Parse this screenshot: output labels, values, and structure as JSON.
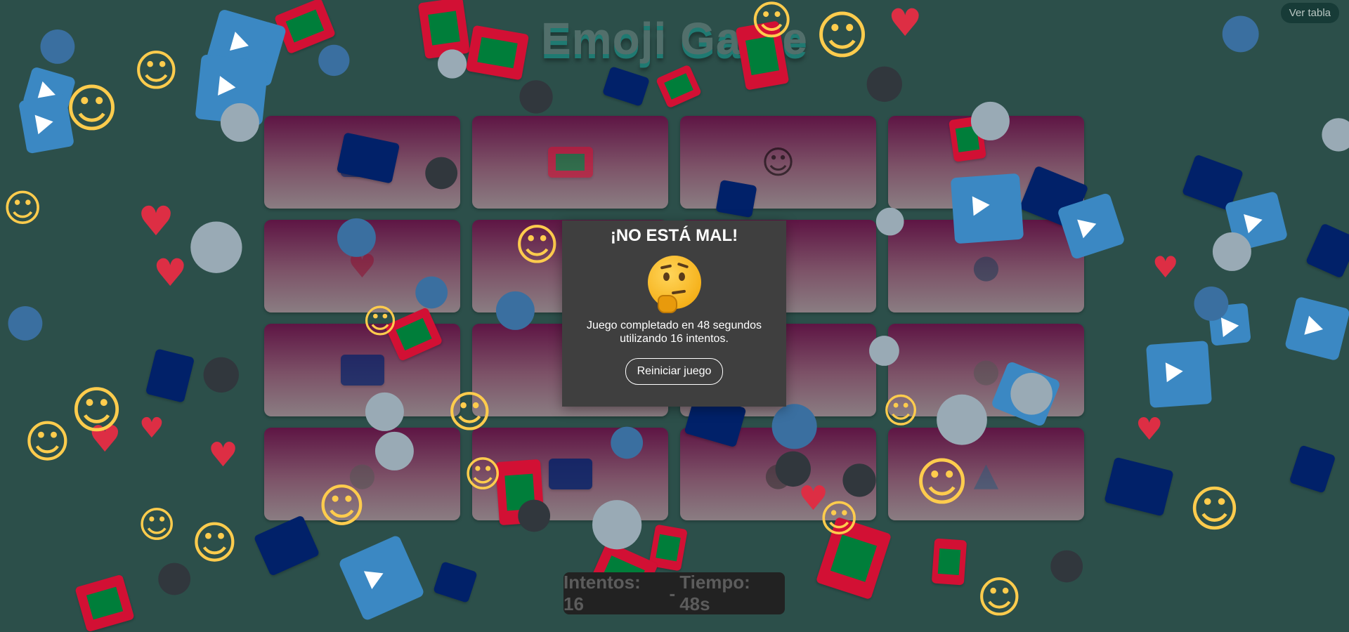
{
  "title": "Emoji Game",
  "leaderboard_label": "Ver tabla",
  "board": {
    "cards": [
      {
        "icon": "anguilla-flag"
      },
      {
        "icon": "maldives-flag"
      },
      {
        "icon": "person-with-veil"
      },
      {
        "icon": "blank"
      },
      {
        "icon": "red-heart"
      },
      {
        "icon": "blank"
      },
      {
        "icon": "blank"
      },
      {
        "icon": "speaking-head"
      },
      {
        "icon": "anguilla-flag"
      },
      {
        "icon": "blank"
      },
      {
        "icon": "blank"
      },
      {
        "icon": "elephant"
      },
      {
        "icon": "elephant"
      },
      {
        "icon": "anguilla-flag"
      },
      {
        "icon": "water-buffalo"
      },
      {
        "icon": "fast-up-button"
      }
    ]
  },
  "status": {
    "attempts_label": "Intentos: 16",
    "separator": "-",
    "time_label": "Tiempo: 48s"
  },
  "modal": {
    "title": "¡NO ESTÁ MAL!",
    "emoji": "thinking-face",
    "message": "Juego completado en 48 segundos utilizando 16 intentos.",
    "restart_label": "Reiniciar juego"
  },
  "confetti": {
    "icons": [
      "maldives-flag",
      "anguilla-flag",
      "elephant",
      "water-buffalo",
      "person-with-veil",
      "fast-forward-button",
      "fast-up-button",
      "red-heart",
      "blue-bird"
    ]
  }
}
